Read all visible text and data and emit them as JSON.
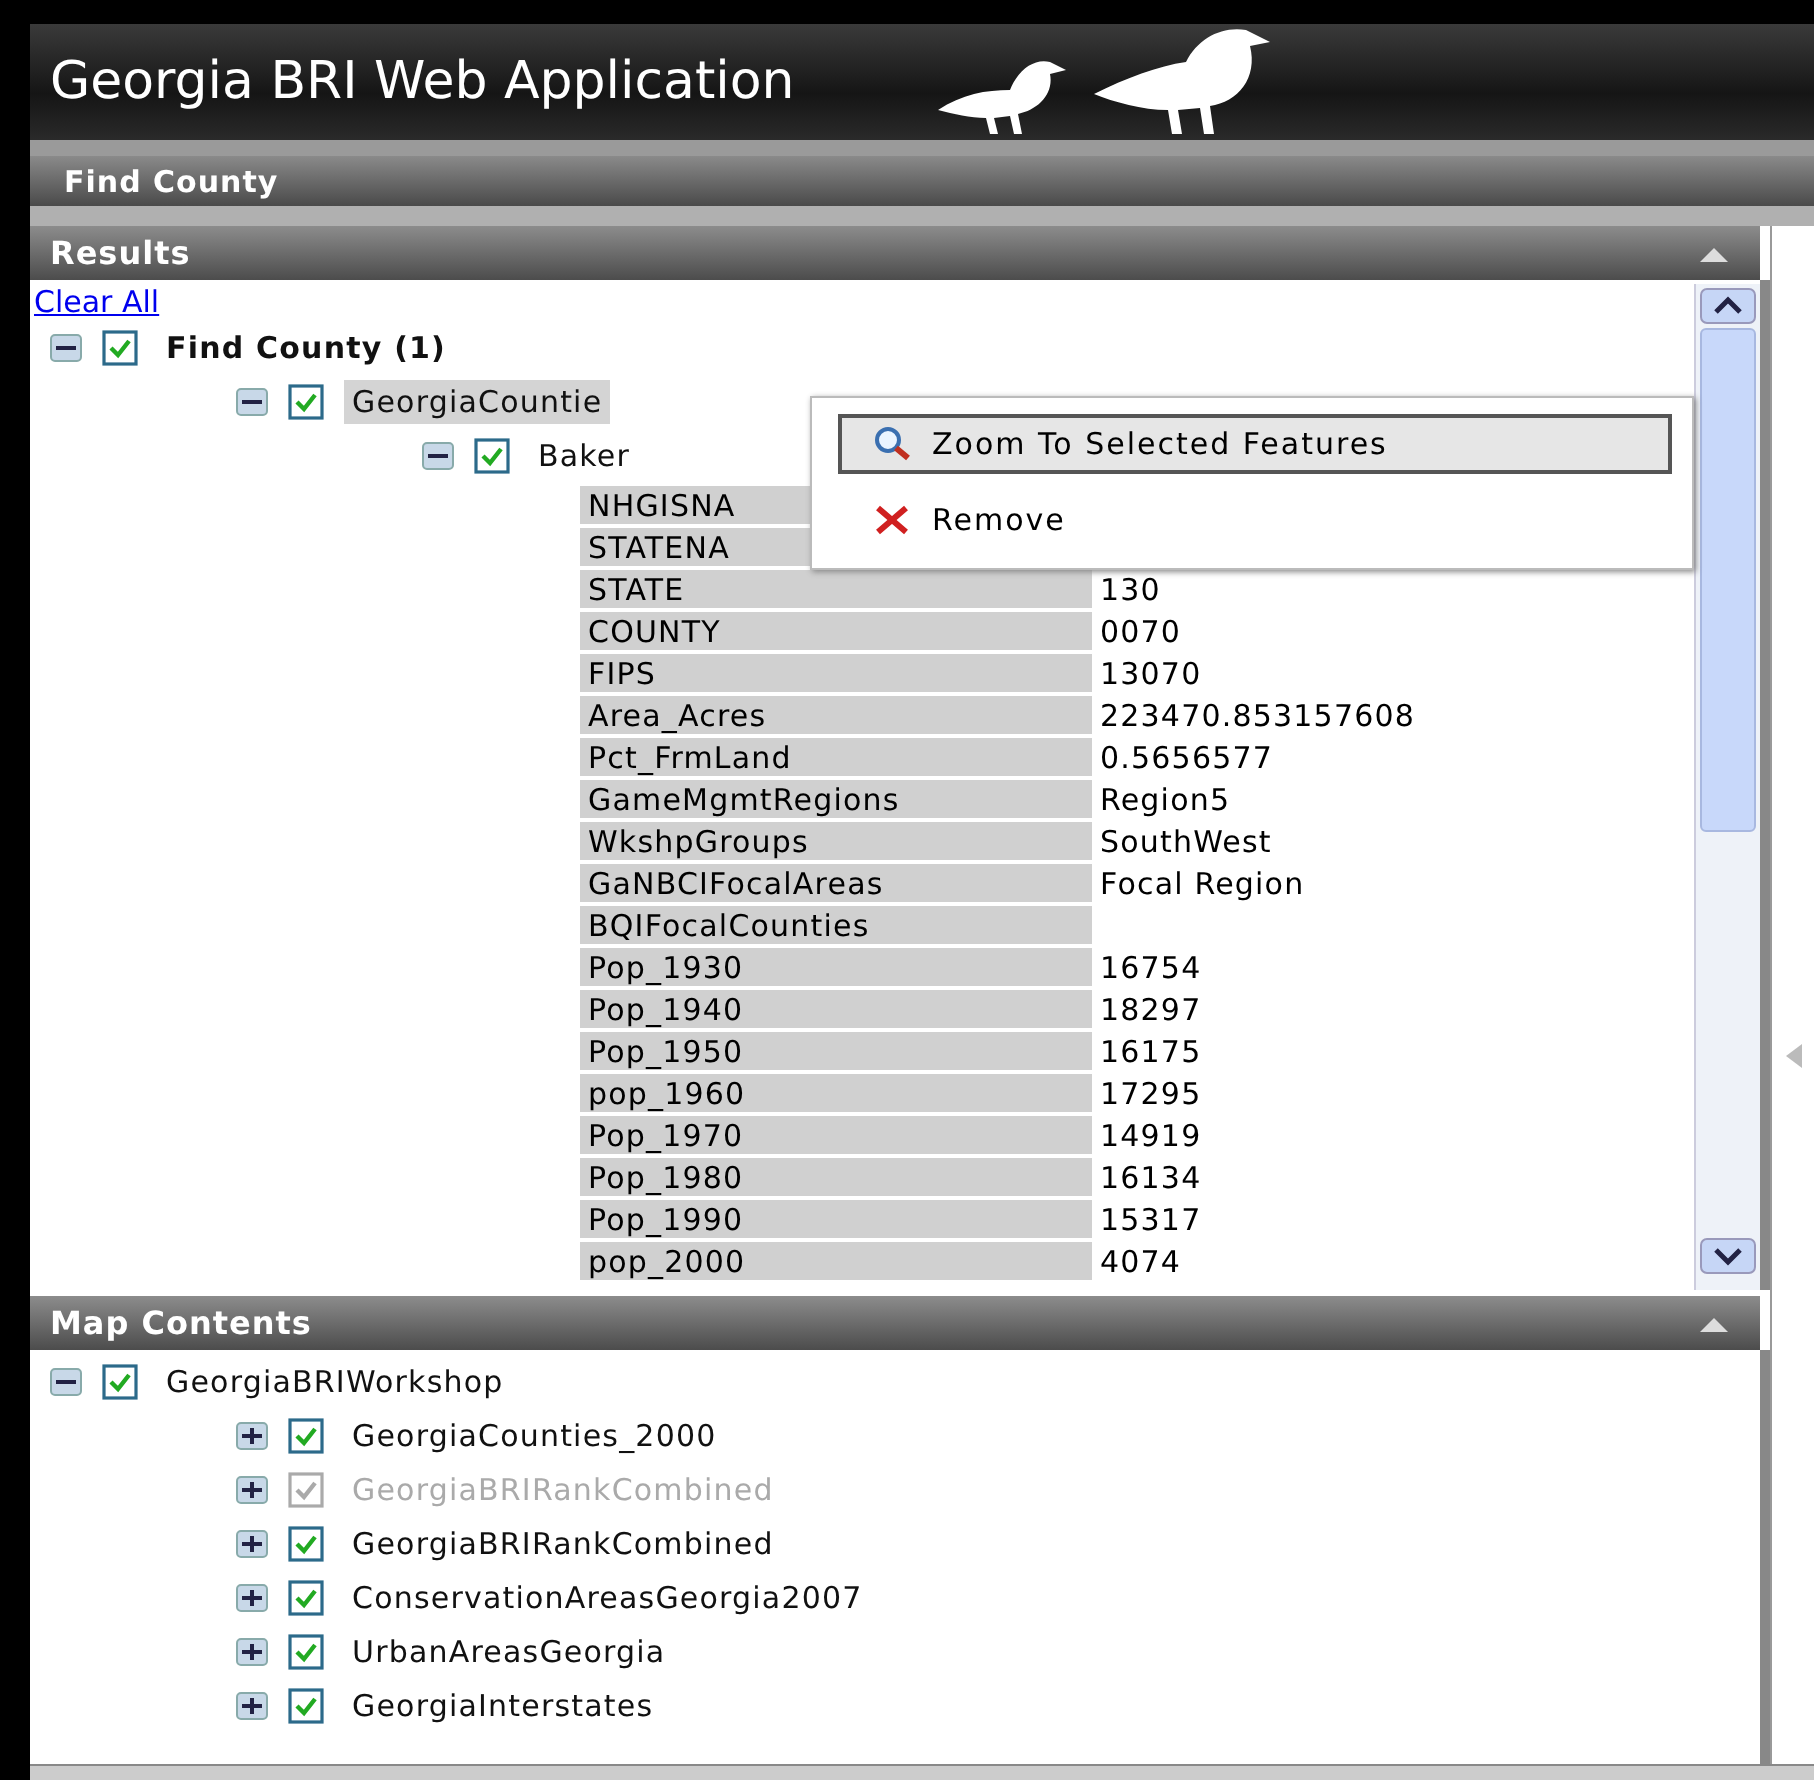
{
  "header": {
    "title": "Georgia BRI Web Application"
  },
  "tool_bar": {
    "title": "Find County"
  },
  "results": {
    "title": "Results",
    "clear_link": "Clear All",
    "tree": [
      {
        "label": "Find County (1)",
        "bold": true,
        "expanded": true,
        "checked": true,
        "selected": false,
        "children": [
          {
            "label": "GeorgiaCountie",
            "bold": false,
            "expanded": true,
            "checked": true,
            "selected": true,
            "children": [
              {
                "label": "Baker",
                "bold": false,
                "expanded": true,
                "checked": true,
                "selected": false,
                "attributes": [
                  {
                    "name": "NHGISNA"
                  },
                  {
                    "name": "STATENA"
                  },
                  {
                    "name": "STATE",
                    "value": "130"
                  },
                  {
                    "name": "COUNTY",
                    "value": "0070"
                  },
                  {
                    "name": "FIPS",
                    "value": "13070"
                  },
                  {
                    "name": "Area_Acres",
                    "value": "223470.853157608"
                  },
                  {
                    "name": "Pct_FrmLand",
                    "value": "0.5656577"
                  },
                  {
                    "name": "GameMgmtRegions",
                    "value": "Region5"
                  },
                  {
                    "name": "WkshpGroups",
                    "value": "SouthWest"
                  },
                  {
                    "name": "GaNBCIFocalAreas",
                    "value": "Focal Region"
                  },
                  {
                    "name": "BQIFocalCounties"
                  },
                  {
                    "name": "Pop_1930",
                    "value": "16754"
                  },
                  {
                    "name": "Pop_1940",
                    "value": "18297"
                  },
                  {
                    "name": "Pop_1950",
                    "value": "16175"
                  },
                  {
                    "name": "pop_1960",
                    "value": "17295"
                  },
                  {
                    "name": "Pop_1970",
                    "value": "14919"
                  },
                  {
                    "name": "Pop_1980",
                    "value": "16134"
                  },
                  {
                    "name": "Pop_1990",
                    "value": "15317"
                  },
                  {
                    "name": "pop_2000",
                    "value": "4074"
                  }
                ]
              }
            ]
          }
        ]
      }
    ]
  },
  "context_menu": {
    "items": [
      {
        "label": "Zoom To Selected Features",
        "kind": "zoom",
        "selected": true
      },
      {
        "label": "Remove",
        "kind": "remove",
        "selected": false
      }
    ]
  },
  "map_contents": {
    "title": "Map Contents",
    "tree": [
      {
        "label": "GeorgiaBRIWorkshop",
        "expanded": true,
        "checked": true,
        "disabled": false,
        "children": [
          {
            "label": "GeorgiaCounties_2000",
            "expanded": false,
            "checked": true,
            "disabled": false
          },
          {
            "label": "GeorgiaBRIRankCombined",
            "expanded": false,
            "checked": true,
            "disabled": true
          },
          {
            "label": "GeorgiaBRIRankCombined",
            "expanded": false,
            "checked": true,
            "disabled": false
          },
          {
            "label": "ConservationAreasGeorgia2007",
            "expanded": false,
            "checked": true,
            "disabled": false
          },
          {
            "label": "UrbanAreasGeorgia",
            "expanded": false,
            "checked": true,
            "disabled": false
          },
          {
            "label": "GeorgiaInterstates",
            "expanded": false,
            "checked": true,
            "disabled": false
          }
        ]
      }
    ]
  }
}
